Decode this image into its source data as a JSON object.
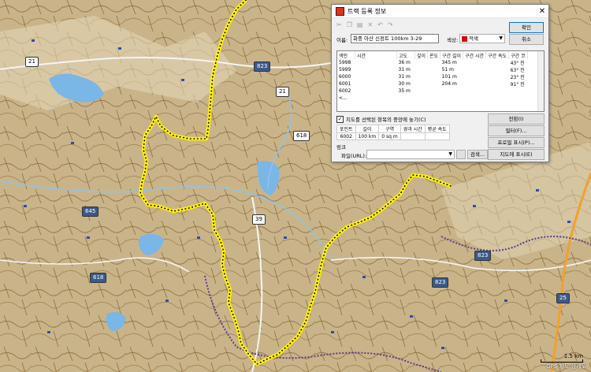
{
  "map": {
    "road_badges": [
      "21",
      "823",
      "21",
      "618",
      "645",
      "39",
      "618",
      "823",
      "823",
      "25"
    ],
    "scale_label": "1.5 km",
    "credit": "GPS 지도 상세도",
    "track_color": "#fff200"
  },
  "dialog": {
    "title": "트랙 등록 정보",
    "ok_label": "확인",
    "cancel_label": "취소",
    "name_label": "이름:",
    "name_value": "화중 아산 신정트 100km 3-29",
    "color_label": "색상:",
    "color_value": "적색",
    "color_hex": "#e00000",
    "columns": [
      "색인",
      "시간",
      "고도",
      "깊이",
      "온도",
      "구간 길이",
      "구간 시간",
      "구간 속도",
      "구간 코"
    ],
    "rows": [
      [
        "5998",
        "",
        "36 m",
        "",
        "",
        "345 m",
        "",
        "",
        "43° 진"
      ],
      [
        "5999",
        "",
        "31 m",
        "",
        "",
        "51 m",
        "",
        "",
        "63° 진"
      ],
      [
        "6000",
        "",
        "31 m",
        "",
        "",
        "101 m",
        "",
        "",
        "23° 진"
      ],
      [
        "6001",
        "",
        "30 m",
        "",
        "",
        "204 m",
        "",
        "",
        "91° 진"
      ],
      [
        "6002",
        "",
        "35 m",
        "",
        "",
        "",
        "",
        "",
        ""
      ]
    ],
    "row_ellipsis": "<...",
    "center_checkbox_label": "지도를 선택된 항목의 중앙에 놓기(C)",
    "center_checked": true,
    "summary_columns": [
      "포인트",
      "길이",
      "구역",
      "경과 시간",
      "평균 속도"
    ],
    "summary_values": [
      "6002",
      "100 km",
      "0 sq m",
      "",
      ""
    ],
    "link_label": "링크",
    "file_label": "파일(URL):",
    "browse_label": "검색...",
    "btn_reverse": "전환(I)",
    "btn_filter": "필터(F)...",
    "btn_profile": "프로필 표시(P)...",
    "btn_show_on_map": "지도에 표시(E)"
  }
}
